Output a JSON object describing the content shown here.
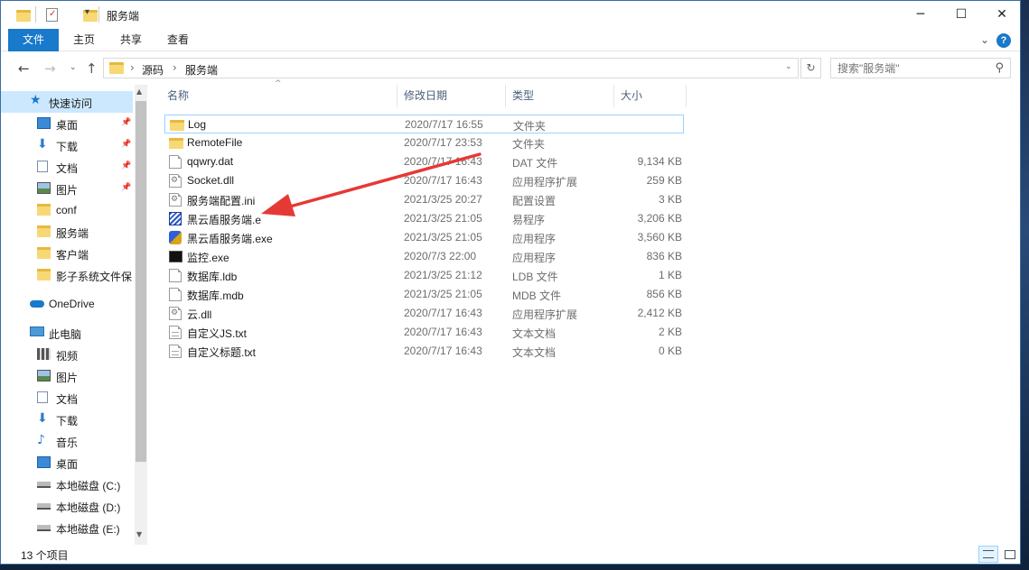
{
  "window": {
    "title": "服务端",
    "controls": {
      "minimize": "─",
      "maximize": "☐",
      "close": "✕"
    }
  },
  "ribbon": {
    "tabs": [
      "文件",
      "主页",
      "共享",
      "查看"
    ],
    "help": "?"
  },
  "address": {
    "crumbs": [
      "源码",
      "服务端"
    ],
    "search_placeholder": "搜索\"服务端\""
  },
  "sidebar": {
    "quick_access": "快速访问",
    "quick_items": [
      {
        "label": "桌面",
        "icon": "desktop-icon",
        "pinned": true
      },
      {
        "label": "下载",
        "icon": "download-icon",
        "pinned": true
      },
      {
        "label": "文档",
        "icon": "document-icon",
        "pinned": true
      },
      {
        "label": "图片",
        "icon": "picture-icon",
        "pinned": true
      },
      {
        "label": "conf",
        "icon": "folder-icon",
        "pinned": false
      },
      {
        "label": "服务端",
        "icon": "folder-icon",
        "pinned": false
      },
      {
        "label": "客户端",
        "icon": "folder-icon",
        "pinned": false
      },
      {
        "label": "影子系统文件保",
        "icon": "folder-icon",
        "pinned": false
      }
    ],
    "onedrive": "OneDrive",
    "this_pc": "此电脑",
    "pc_items": [
      {
        "label": "视频",
        "icon": "video-icon"
      },
      {
        "label": "图片",
        "icon": "picture-icon"
      },
      {
        "label": "文档",
        "icon": "document-icon"
      },
      {
        "label": "下载",
        "icon": "download-icon"
      },
      {
        "label": "音乐",
        "icon": "music-icon"
      },
      {
        "label": "桌面",
        "icon": "desktop-icon"
      },
      {
        "label": "本地磁盘 (C:)",
        "icon": "drive-icon"
      },
      {
        "label": "本地磁盘 (D:)",
        "icon": "drive-icon"
      },
      {
        "label": "本地磁盘 (E:)",
        "icon": "drive-icon"
      }
    ]
  },
  "columns": {
    "name": "名称",
    "date": "修改日期",
    "type": "类型",
    "size": "大小"
  },
  "files": [
    {
      "name": "Log",
      "date": "2020/7/17 16:55",
      "type": "文件夹",
      "size": "",
      "icon": "folder-icon"
    },
    {
      "name": "RemoteFile",
      "date": "2020/7/17 23:53",
      "type": "文件夹",
      "size": "",
      "icon": "folder-icon"
    },
    {
      "name": "qqwry.dat",
      "date": "2020/7/17 16:43",
      "type": "DAT 文件",
      "size": "9,134 KB",
      "icon": "file-icon"
    },
    {
      "name": "Socket.dll",
      "date": "2020/7/17 16:43",
      "type": "应用程序扩展",
      "size": "259 KB",
      "icon": "dll-icon"
    },
    {
      "name": "服务端配置.ini",
      "date": "2021/3/25 20:27",
      "type": "配置设置",
      "size": "3 KB",
      "icon": "settings-file-icon"
    },
    {
      "name": "黑云盾服务端.e",
      "date": "2021/3/25 21:05",
      "type": "易程序",
      "size": "3,206 KB",
      "icon": "e-program-icon"
    },
    {
      "name": "黑云盾服务端.exe",
      "date": "2021/3/25 21:05",
      "type": "应用程序",
      "size": "3,560 KB",
      "icon": "app-icon"
    },
    {
      "name": "监控.exe",
      "date": "2020/7/3 22:00",
      "type": "应用程序",
      "size": "836 KB",
      "icon": "console-icon"
    },
    {
      "name": "数据库.ldb",
      "date": "2021/3/25 21:12",
      "type": "LDB 文件",
      "size": "1 KB",
      "icon": "file-icon"
    },
    {
      "name": "数据库.mdb",
      "date": "2021/3/25 21:05",
      "type": "MDB 文件",
      "size": "856 KB",
      "icon": "file-icon"
    },
    {
      "name": "云.dll",
      "date": "2020/7/17 16:43",
      "type": "应用程序扩展",
      "size": "2,412 KB",
      "icon": "dll-icon"
    },
    {
      "name": "自定义JS.txt",
      "date": "2020/7/17 16:43",
      "type": "文本文档",
      "size": "2 KB",
      "icon": "text-file-icon"
    },
    {
      "name": "自定义标题.txt",
      "date": "2020/7/17 16:43",
      "type": "文本文档",
      "size": "0 KB",
      "icon": "text-file-icon"
    }
  ],
  "status": {
    "count": "13 个项目"
  },
  "colors": {
    "accent": "#1979ca",
    "selection": "#cce8ff",
    "annotation_arrow": "#e53935"
  }
}
